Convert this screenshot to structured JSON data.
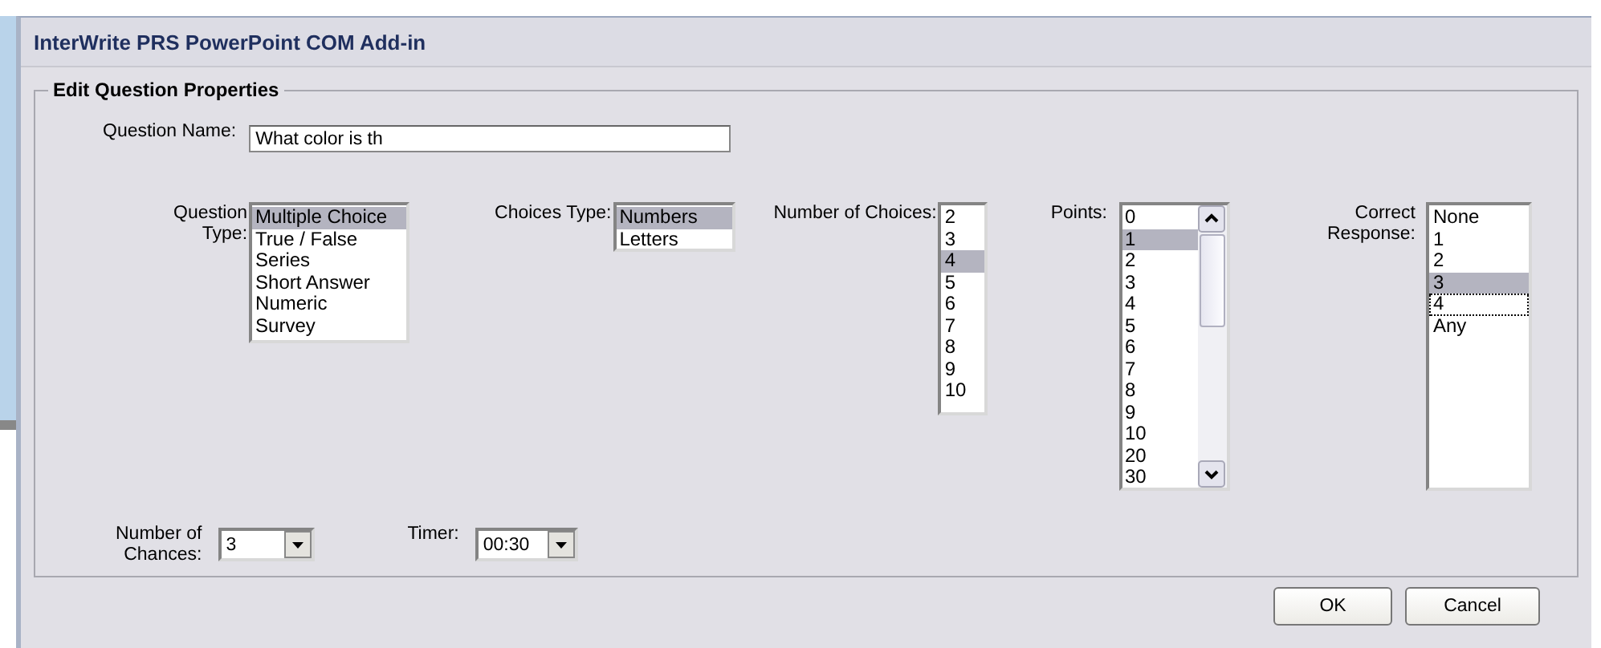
{
  "window": {
    "title": "InterWrite PRS PowerPoint COM Add-in"
  },
  "group": {
    "title": "Edit Question Properties"
  },
  "question_name": {
    "label": "Question Name:",
    "value": "What color is th"
  },
  "lists": [
    {
      "label_lines": [
        "Question",
        "Type:"
      ],
      "items": [
        {
          "text": "Multiple Choice",
          "selected": true
        },
        {
          "text": "True / False",
          "selected": false
        },
        {
          "text": "Series",
          "selected": false
        },
        {
          "text": "Short Answer",
          "selected": false
        },
        {
          "text": "Numeric",
          "selected": false
        },
        {
          "text": "Survey",
          "selected": false
        }
      ]
    },
    {
      "label_lines": [
        "Choices Type:"
      ],
      "items": [
        {
          "text": "Numbers",
          "selected": true
        },
        {
          "text": "Letters",
          "selected": false
        }
      ]
    },
    {
      "label_lines": [
        "Number of Choices:"
      ],
      "items": [
        {
          "text": "2",
          "selected": false
        },
        {
          "text": "3",
          "selected": false
        },
        {
          "text": "4",
          "selected": true
        },
        {
          "text": "5",
          "selected": false
        },
        {
          "text": "6",
          "selected": false
        },
        {
          "text": "7",
          "selected": false
        },
        {
          "text": "8",
          "selected": false
        },
        {
          "text": "9",
          "selected": false
        },
        {
          "text": "10",
          "selected": false
        }
      ]
    },
    {
      "label_lines": [
        "Points:"
      ],
      "scrollbar": true,
      "items": [
        {
          "text": "0",
          "selected": false
        },
        {
          "text": "1",
          "selected": true
        },
        {
          "text": "2",
          "selected": false
        },
        {
          "text": "3",
          "selected": false
        },
        {
          "text": "4",
          "selected": false
        },
        {
          "text": "5",
          "selected": false
        },
        {
          "text": "6",
          "selected": false
        },
        {
          "text": "7",
          "selected": false
        },
        {
          "text": "8",
          "selected": false
        },
        {
          "text": "9",
          "selected": false
        },
        {
          "text": "10",
          "selected": false
        },
        {
          "text": "20",
          "selected": false
        },
        {
          "text": "30",
          "selected": false
        }
      ]
    },
    {
      "label_lines": [
        "Correct",
        "Response:"
      ],
      "items": [
        {
          "text": "None",
          "selected": false,
          "focused": false
        },
        {
          "text": "1",
          "selected": false,
          "focused": false
        },
        {
          "text": "2",
          "selected": false,
          "focused": false
        },
        {
          "text": "3",
          "selected": true,
          "focused": false
        },
        {
          "text": "4",
          "selected": false,
          "focused": true
        },
        {
          "text": "Any",
          "selected": false,
          "focused": false
        }
      ]
    }
  ],
  "combos": [
    {
      "label_lines": [
        "Number of",
        "Chances:"
      ],
      "value": "3"
    },
    {
      "label_lines": [
        "Timer:"
      ],
      "value": "00:30"
    }
  ],
  "buttons": [
    "OK",
    "Cancel"
  ]
}
